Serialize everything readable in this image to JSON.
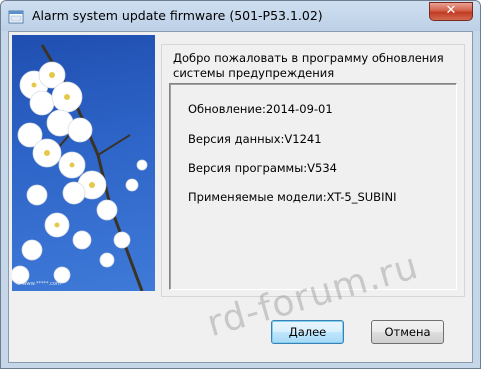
{
  "window": {
    "title": "Alarm system update firmware (501-P53.1.02)",
    "close_symbol": "✕"
  },
  "welcome": {
    "text": "Добро пожаловать в программу обновления системы предупреждения"
  },
  "info": {
    "update": "Обновление:2014-09-01",
    "data_version": "Версия данных:V1241",
    "program_version": "Версия программы:V534",
    "models": "Применяемые модели:XT-5_SUBINI"
  },
  "buttons": {
    "next": "Далее",
    "cancel": "Отмена"
  },
  "photo": {
    "credit": "© www.*****.com"
  },
  "watermark": {
    "text": "rd-forum.ru"
  },
  "colors": {
    "title_bar": "#c6d7ea",
    "close_button": "#c23a22",
    "sky": "#2e65c8",
    "blossom": "#ffffff",
    "dialog_bg": "#f0f0f0"
  },
  "icons": {
    "app": "app-icon",
    "close": "close-icon"
  }
}
